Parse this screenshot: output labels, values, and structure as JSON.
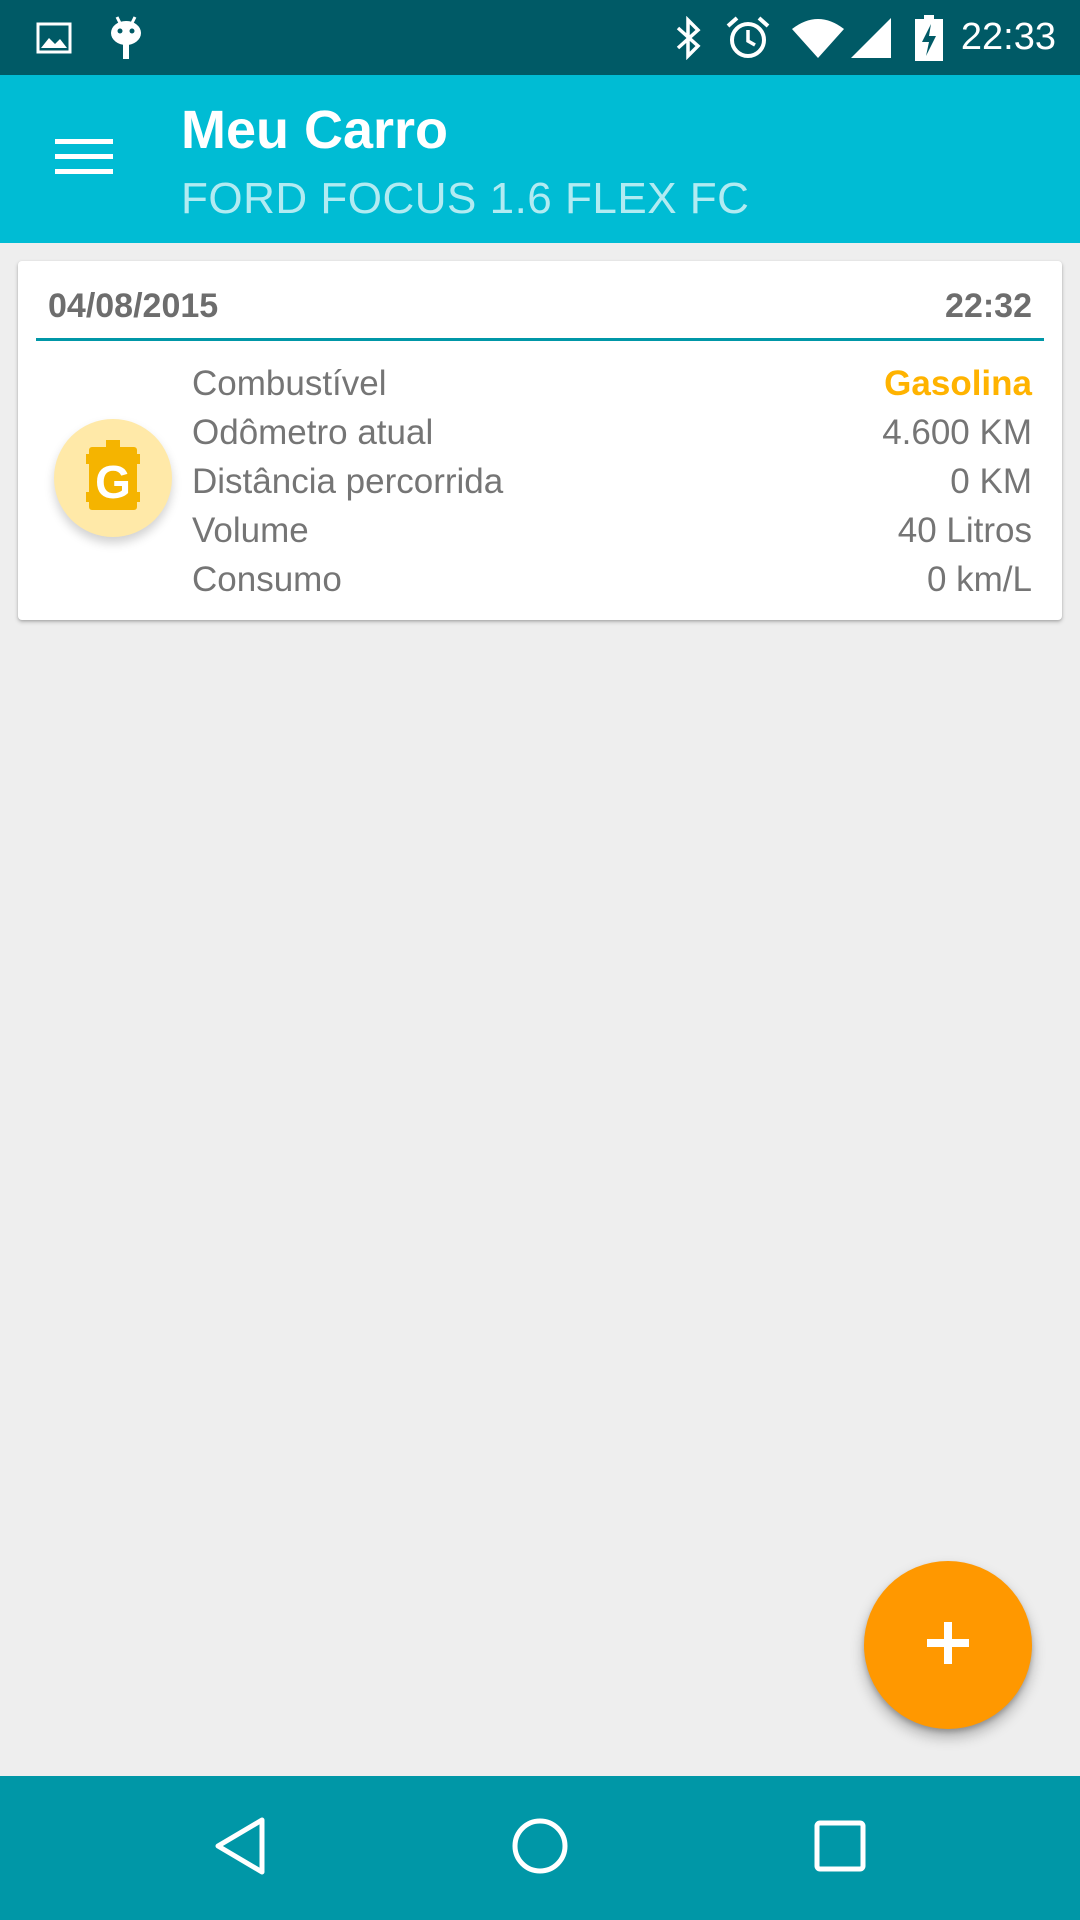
{
  "status_bar": {
    "time": "22:33",
    "icons": [
      "image-icon",
      "android-debug-icon",
      "bluetooth-icon",
      "alarm-icon",
      "wifi-icon",
      "cell-signal-icon",
      "battery-charging-icon"
    ]
  },
  "app_bar": {
    "title": "Meu Carro",
    "subtitle": "FORD FOCUS 1.6 FLEX FC",
    "menu_icon": "menu-icon",
    "color": "#00bcd4"
  },
  "entries": [
    {
      "date": "04/08/2015",
      "time": "22:32",
      "fuel_icon_letter": "G",
      "rows": [
        {
          "label": "Combustível",
          "value": "Gasolina"
        },
        {
          "label": "Odômetro atual",
          "value": "4.600 KM"
        },
        {
          "label": "Distância percorrida",
          "value": "0 KM"
        },
        {
          "label": "Volume",
          "value": "40 Litros"
        },
        {
          "label": "Consumo",
          "value": "0 km/L"
        }
      ]
    }
  ],
  "fab": {
    "icon": "plus-icon",
    "color": "#ff9800"
  },
  "nav_bar": {
    "icons": [
      "back-icon",
      "home-icon",
      "recents-icon"
    ]
  },
  "colors": {
    "accent": "#ffb300",
    "divider": "#0097a7",
    "status_bar": "#005a66"
  }
}
